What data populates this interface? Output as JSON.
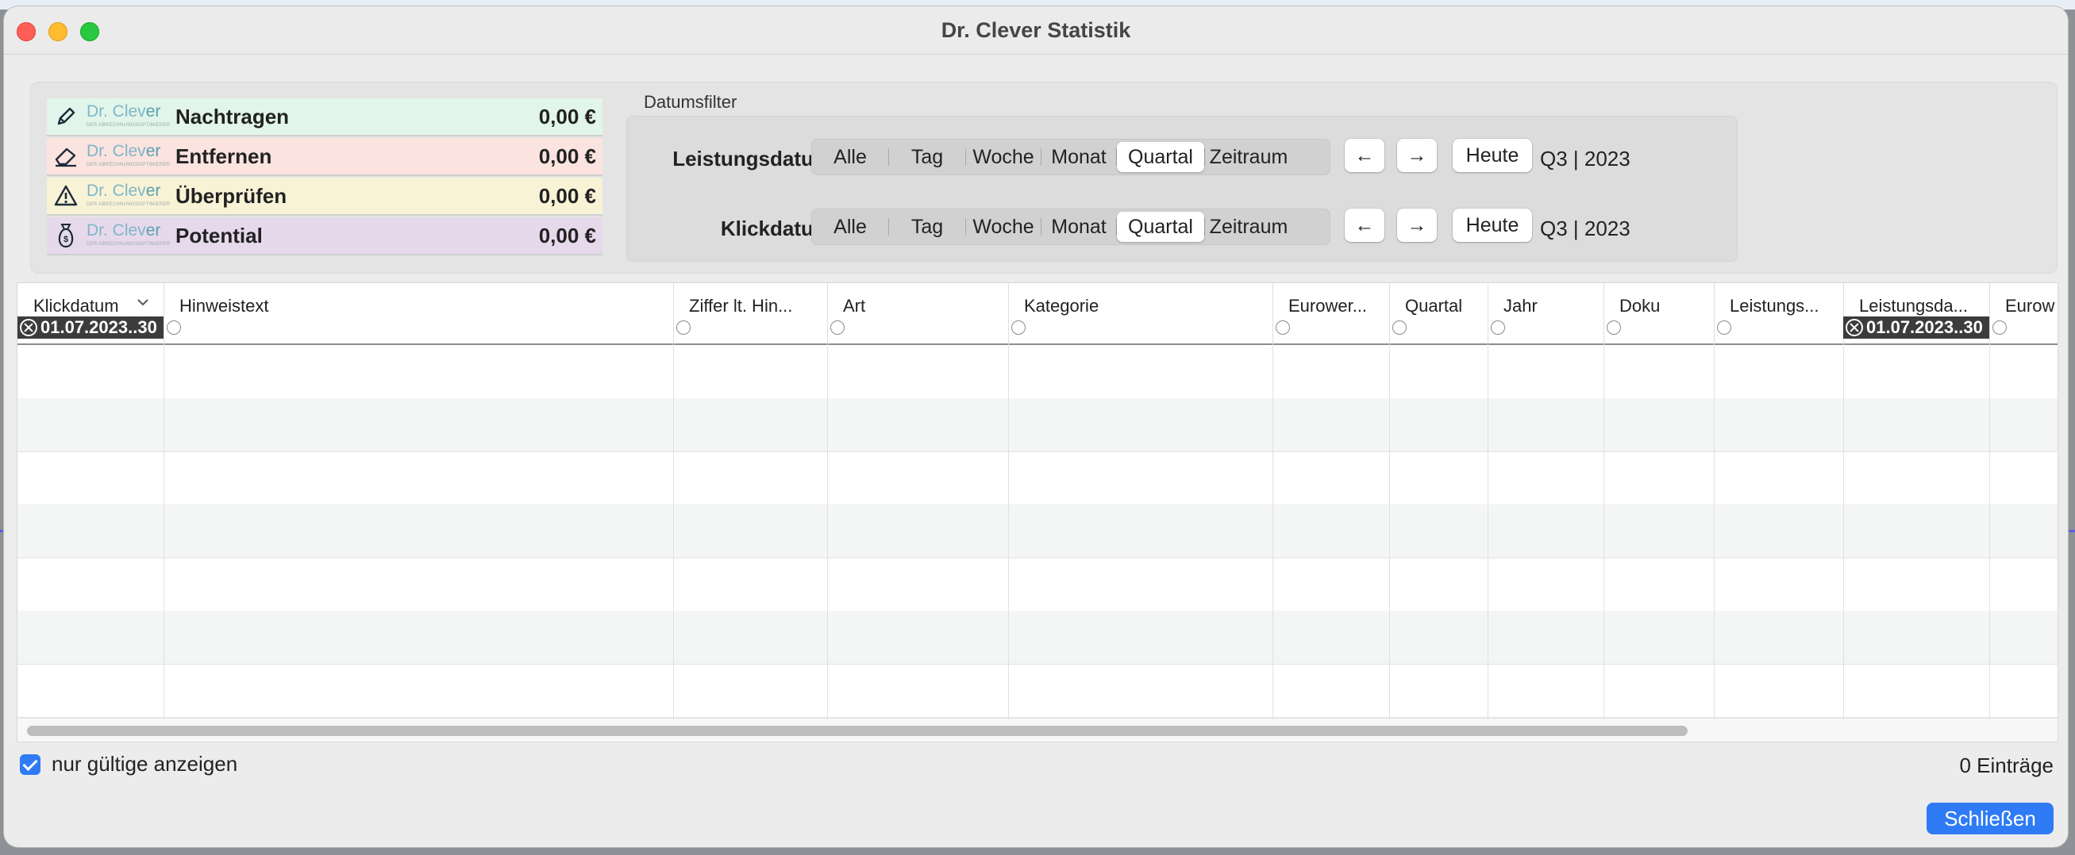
{
  "window": {
    "title": "Dr. Clever Statistik"
  },
  "stats": [
    {
      "label": "Nachtragen",
      "value": "0,00 €",
      "icon": "pencil-icon",
      "color": "#e2f5ea",
      "logo_main": "Dr. Clev",
      "logo_accent": "er",
      "logo_tag": "DER ABRECHNUNGSOPTIMIERER"
    },
    {
      "label": "Entfernen",
      "value": "0,00 €",
      "icon": "eraser-icon",
      "color": "#fbe3df",
      "logo_main": "Dr. Clev",
      "logo_accent": "er",
      "logo_tag": "DER ABRECHNUNGSOPTIMIERER"
    },
    {
      "label": "Überprüfen",
      "value": "0,00 €",
      "icon": "warning-icon",
      "color": "#f8f3d6",
      "logo_main": "Dr. Clev",
      "logo_accent": "er",
      "logo_tag": "DER ABRECHNUNGSOPTIMIERER"
    },
    {
      "label": "Potential",
      "value": "0,00 €",
      "icon": "money-bag-icon",
      "color": "#e7d9ec",
      "logo_main": "Dr. Clev",
      "logo_accent": "er",
      "logo_tag": "DER ABRECHNUNGSOPTIMIERER"
    }
  ],
  "datumsfilter": {
    "title": "Datumsfilter",
    "segments": [
      "Alle",
      "Tag",
      "Woche",
      "Monat",
      "Quartal",
      "Zeitraum"
    ],
    "selected": "Quartal",
    "prev_label": "←",
    "next_label": "→",
    "today_label": "Heute",
    "rows": [
      {
        "label": "Leistungsdatum",
        "period": "Q3 | 2023"
      },
      {
        "label": "Klickdatum",
        "period": "Q3 | 2023"
      }
    ]
  },
  "table": {
    "columns": [
      {
        "title": "Klickdatum",
        "sort": "chevron-down-icon",
        "filter": "01.07.2023..30"
      },
      {
        "title": "Hinweistext",
        "filter": ""
      },
      {
        "title": "Ziffer lt. Hin...",
        "filter": ""
      },
      {
        "title": "Art",
        "filter": ""
      },
      {
        "title": "Kategorie",
        "filter": ""
      },
      {
        "title": "Eurower...",
        "filter": ""
      },
      {
        "title": "Quartal",
        "filter": ""
      },
      {
        "title": "Jahr",
        "filter": ""
      },
      {
        "title": "Doku",
        "filter": ""
      },
      {
        "title": "Leistungs...",
        "filter": ""
      },
      {
        "title": "Leistungsda...",
        "filter": "01.07.2023..30"
      },
      {
        "title": "Eurow",
        "filter": ""
      }
    ],
    "empty_rows": 7
  },
  "footer": {
    "checkbox_label": "nur gültige anzeigen",
    "checkbox_checked": true,
    "entries_label": "0 Einträge",
    "close_label": "Schließen"
  }
}
